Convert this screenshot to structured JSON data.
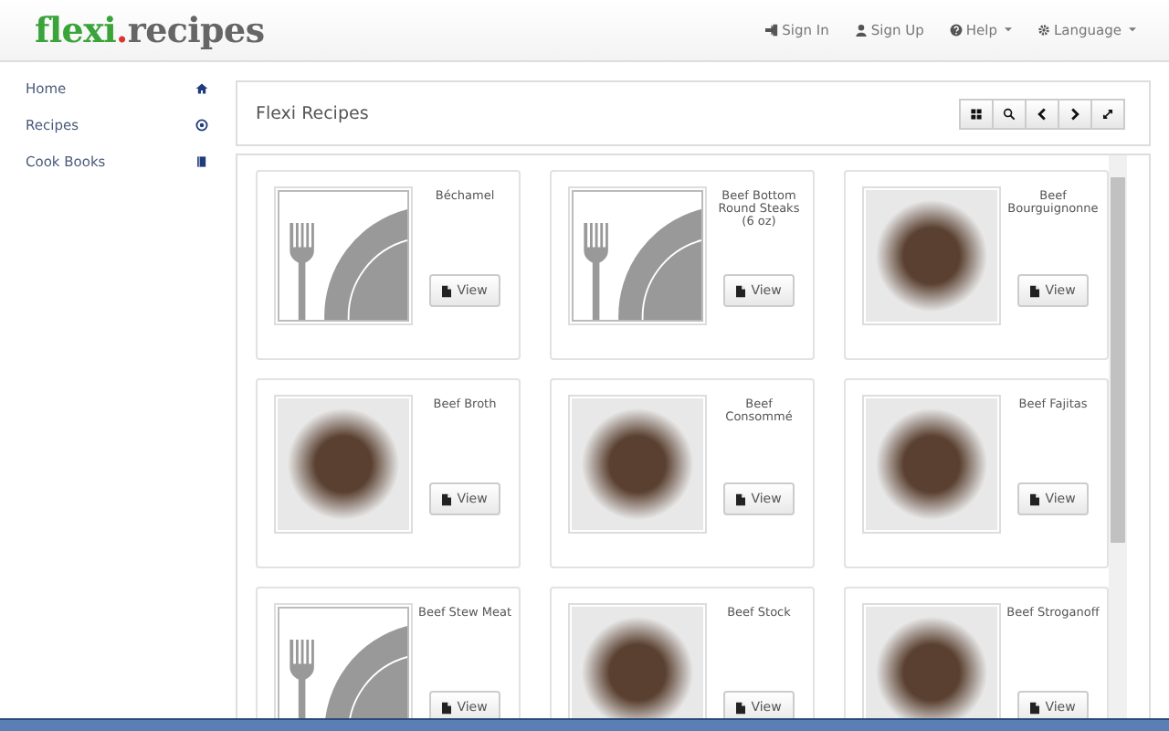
{
  "logo": {
    "parts": [
      "flexi",
      ".",
      "recipes"
    ]
  },
  "nav": [
    {
      "label": "Sign In",
      "dropdown": false
    },
    {
      "label": "Sign Up",
      "dropdown": false
    },
    {
      "label": "Help",
      "dropdown": true
    },
    {
      "label": "Language",
      "dropdown": true
    }
  ],
  "sidebar": {
    "items": [
      {
        "label": "Home"
      },
      {
        "label": "Recipes"
      },
      {
        "label": "Cook Books"
      }
    ]
  },
  "panel": {
    "title": "Flexi Recipes"
  },
  "recipes": [
    {
      "name": "Béchamel",
      "kind": "placeholder",
      "button": "View"
    },
    {
      "name": "Beef Bottom Round Steaks (6 oz)",
      "kind": "placeholder",
      "button": "View"
    },
    {
      "name": "Beef Bourguignonne",
      "kind": "photo",
      "button": "View"
    },
    {
      "name": "Beef Broth",
      "kind": "photo",
      "button": "View"
    },
    {
      "name": "Beef Consommé",
      "kind": "photo",
      "button": "View"
    },
    {
      "name": "Beef Fajitas",
      "kind": "photo",
      "button": "View"
    },
    {
      "name": "Beef Stew Meat",
      "kind": "placeholder",
      "button": "View"
    },
    {
      "name": "Beef Stock",
      "kind": "photo",
      "button": "View"
    },
    {
      "name": "Beef Stroganoff",
      "kind": "photo",
      "button": "View"
    }
  ]
}
